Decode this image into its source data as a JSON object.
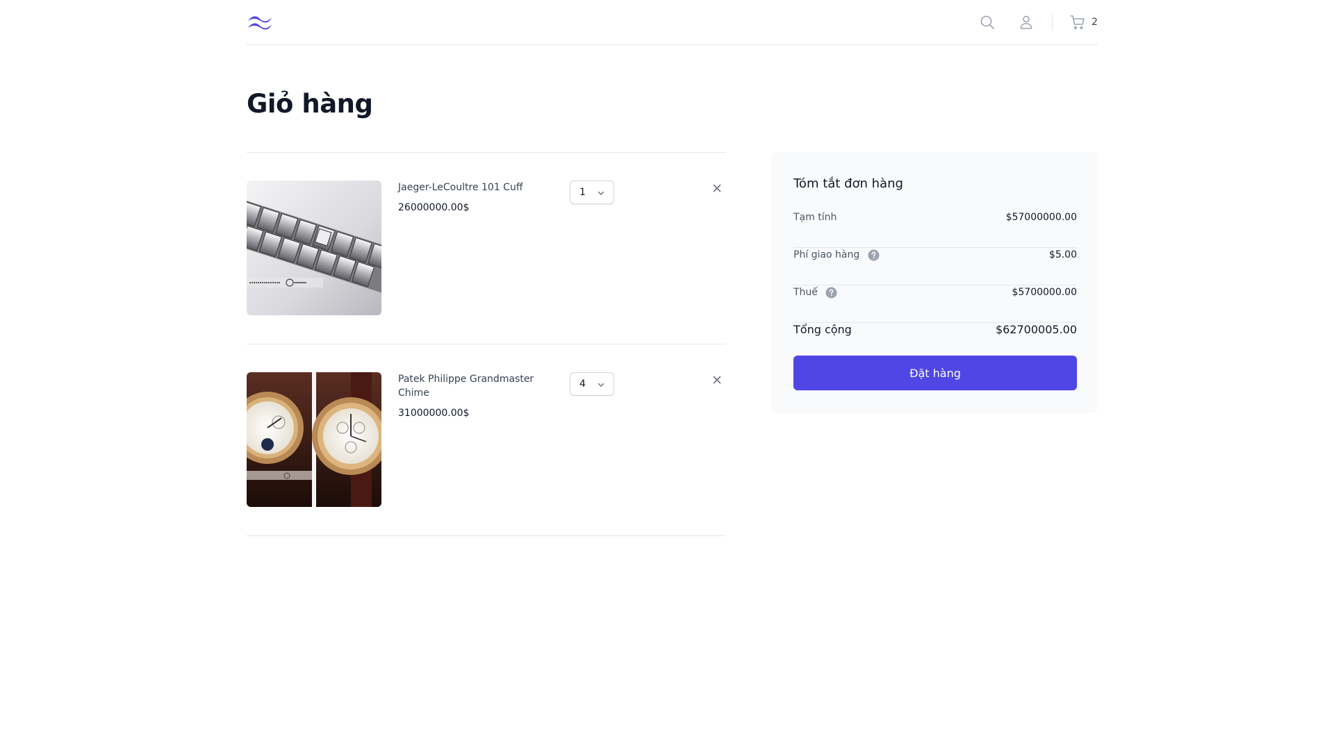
{
  "header": {
    "cart_count": "2",
    "icons": {
      "logo": "tailwind-wave-logo",
      "search": "search-icon",
      "account": "user-icon",
      "cart": "cart-icon"
    }
  },
  "page": {
    "title": "Giỏ hàng"
  },
  "cart": {
    "items": [
      {
        "name": "Jaeger-LeCoultre 101 Cuff",
        "price": "26000000.00$",
        "quantity": "1",
        "image": "Jaeger-LeCoultre 101 Cuff product image"
      },
      {
        "name": "Patek Philippe Grandmaster Chime",
        "price": "31000000.00$",
        "quantity": "4",
        "image": "Patek Philippe Grandmaster Chime product image"
      }
    ]
  },
  "summary": {
    "title": "Tóm tắt đơn hàng",
    "subtotal_label": "Tạm tính",
    "subtotal_value": "$57000000.00",
    "shipping_label": "Phí giao hàng",
    "shipping_value": "$5.00",
    "tax_label": "Thuế",
    "tax_value": "$5700000.00",
    "total_label": "Tổng cộng",
    "total_value": "$62700005.00",
    "checkout_label": "Đặt hàng"
  },
  "colors": {
    "accent": "#4f46e5",
    "logo": "#4f46e5",
    "summary_bg": "#f9fafb",
    "border": "#e5e7eb"
  }
}
